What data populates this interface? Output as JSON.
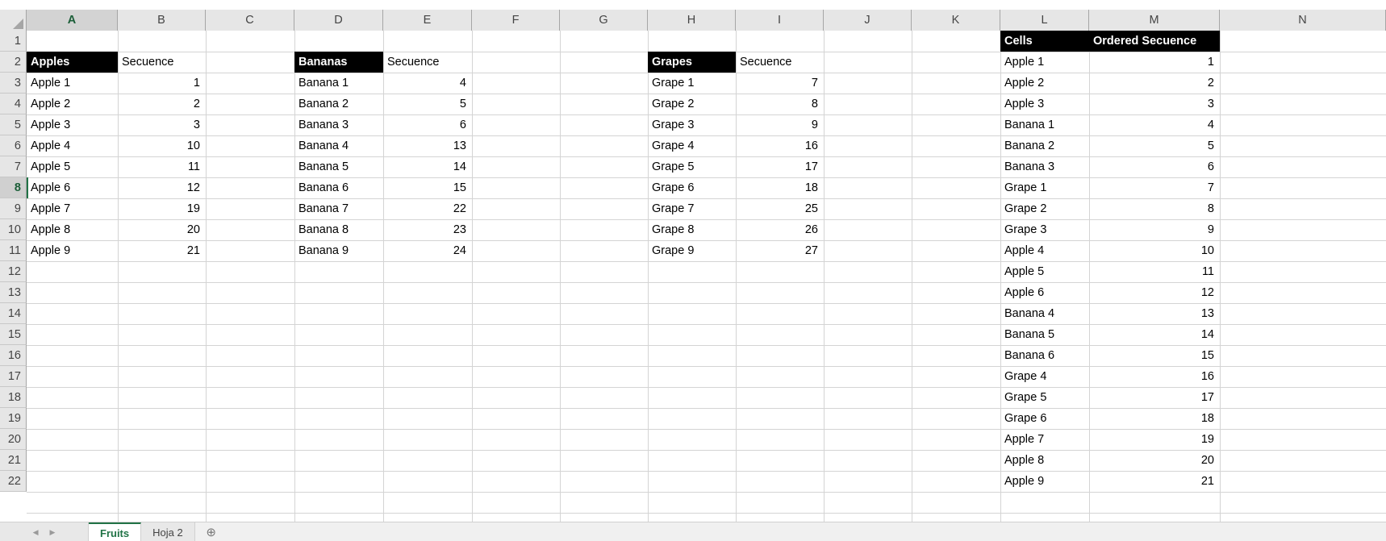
{
  "app": {
    "name": "spreadsheet"
  },
  "grid": {
    "columns": [
      "A",
      "B",
      "C",
      "D",
      "E",
      "F",
      "G",
      "H",
      "I",
      "J",
      "K",
      "L",
      "M",
      "N"
    ],
    "active_column": "A",
    "rows": [
      "1",
      "2",
      "3",
      "4",
      "5",
      "6",
      "7",
      "8",
      "9",
      "10",
      "11",
      "12",
      "13",
      "14",
      "15",
      "16",
      "17",
      "18",
      "19",
      "20",
      "21",
      "22"
    ],
    "active_row": "8",
    "selected_cell": "A8"
  },
  "blocks": {
    "apples": {
      "title": "Apples",
      "seq_label": "Secuence",
      "items": [
        "Apple 1",
        "Apple 2",
        "Apple 3",
        "Apple 4",
        "Apple 5",
        "Apple 6",
        "Apple 7",
        "Apple 8",
        "Apple 9"
      ],
      "values": [
        1,
        2,
        3,
        10,
        11,
        12,
        19,
        20,
        21
      ]
    },
    "bananas": {
      "title": "Bananas",
      "seq_label": "Secuence",
      "items": [
        "Banana 1",
        "Banana 2",
        "Banana 3",
        "Banana 4",
        "Banana 5",
        "Banana 6",
        "Banana 7",
        "Banana 8",
        "Banana 9"
      ],
      "values": [
        4,
        5,
        6,
        13,
        14,
        15,
        22,
        23,
        24
      ]
    },
    "grapes": {
      "title": "Grapes",
      "seq_label": "Secuence",
      "items": [
        "Grape 1",
        "Grape 2",
        "Grape 3",
        "Grape 4",
        "Grape 5",
        "Grape 6",
        "Grape 7",
        "Grape 8",
        "Grape 9"
      ],
      "values": [
        7,
        8,
        9,
        16,
        17,
        18,
        25,
        26,
        27
      ]
    }
  },
  "ordered": {
    "header_cells": "Cells",
    "header_sequence": "Ordered Secuence",
    "cells": [
      "Apple 1",
      "Apple 2",
      "Apple 3",
      "Banana 1",
      "Banana 2",
      "Banana 3",
      "Grape 1",
      "Grape 2",
      "Grape 3",
      "Apple 4",
      "Apple 5",
      "Apple 6",
      "Banana 4",
      "Banana 5",
      "Banana 6",
      "Grape 4",
      "Grape 5",
      "Grape 6",
      "Apple 7",
      "Apple 8",
      "Apple 9"
    ],
    "sequence": [
      1,
      2,
      3,
      4,
      5,
      6,
      7,
      8,
      9,
      10,
      11,
      12,
      13,
      14,
      15,
      16,
      17,
      18,
      19,
      20,
      21
    ]
  },
  "tabs": {
    "prev_label": "◀",
    "next_label": "▶",
    "sheets": [
      {
        "label": "Fruits",
        "active": true
      },
      {
        "label": "Hoja 2",
        "active": false
      }
    ],
    "add_label": "⊕"
  },
  "formula_bar": {
    "name_box_value": "",
    "value": ""
  },
  "colors": {
    "header_fill": "#000000",
    "header_text": "#ffffff",
    "accent": "#217346"
  }
}
